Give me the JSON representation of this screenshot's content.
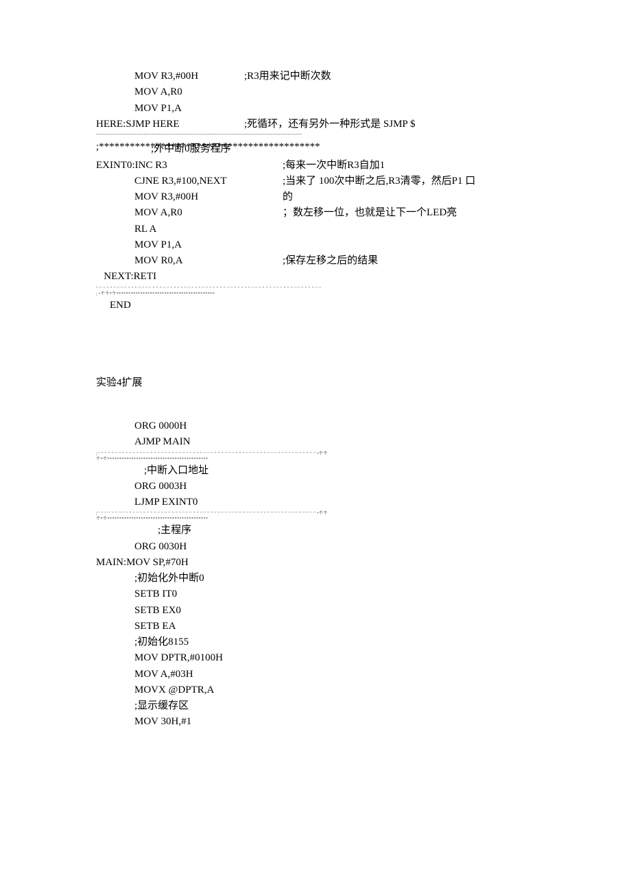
{
  "block1": {
    "lines": [
      {
        "indent": "indent1",
        "code": "MOV R3,#00H",
        "comment": ";R3用来记中断次数",
        "codeWidth": 160
      },
      {
        "indent": "indent1",
        "code": "MOV A,R0",
        "comment": "",
        "codeWidth": 160
      },
      {
        "indent": "indent1",
        "code": "MOV P1,A",
        "comment": "",
        "codeWidth": 160
      },
      {
        "indent": "label-line",
        "code": "HERE:SJMP HERE",
        "comment": ";死循环，还有另外一种形式是  SJMP $",
        "codeWidth": 216
      }
    ],
    "sep1": "''''''''''''''''''''''''''''''''''''''''''''''''''''''''''''''''''''''''''''''''''''''''''''''''''''''''''''''''''''''''''''''''''''''''''''''''''''''''''''''''''''''''''''''''''''''''''''''",
    "headerStars": ";*******************************************",
    "headerLabel": ";外中断0服务程序",
    "serviceLines": [
      {
        "indent": "label-line",
        "code": "EXINT0:INC R3",
        "comment": ";每来一次中断R3自加1",
        "codeWidth": 272
      },
      {
        "indent": "indent1",
        "code": "CJNE R3,#100,NEXT",
        "comment": ";当来了  100次中断之后,R3清零，然后P1 口",
        "codeWidth": 216
      },
      {
        "indent": "indent1",
        "code": "MOV R3,#00H",
        "comment": "的",
        "codeWidth": 216
      },
      {
        "indent": "indent1",
        "code": "MOV A,R0",
        "comment": "；数左移一位，也就是让下一个LED亮",
        "codeWidth": 216
      },
      {
        "indent": "indent1",
        "code": "RL A",
        "comment": "",
        "codeWidth": 216
      },
      {
        "indent": "indent1",
        "code": "MOV P1,A",
        "comment": "",
        "codeWidth": 216
      },
      {
        "indent": "indent1",
        "code": "MOV R0,A",
        "comment": ";保存左移之后的结果",
        "codeWidth": 216
      },
      {
        "indent": "label-line",
        "code": "   NEXT:RETI",
        "comment": "",
        "codeWidth": 216
      }
    ],
    "sep2a": "'' '' '' '' '' '' '' '' '' '' '' '' '' '' '' '' '' '' '' '' '' '' '' '' '' '' '' '' '' '' '' '' '' '' '' '' '' '' '' '' '' '' '' '' '' '' '' '' '' '' '' '' '' '' '' '' '' '' '' '' '' '' '' ''",
    "sep2b": ";                    •个个*个*****************************************",
    "end": "END"
  },
  "block2": {
    "title": "实验4扩展",
    "introLines": [
      {
        "indent": "indent1",
        "code": "ORG 0000H"
      },
      {
        "indent": "indent1",
        "code": "AJMP MAIN"
      }
    ],
    "sep3a": ";'' '' '' '' '' '' '' '' '' '' '' '' '' '' '' '' '' '' '' '' '' '' '' '' '' '' '' '' '' '' '' '' '' '' '' '' '' '' '' '' '' '' '' '' '' '' '' '' '' '' '' '' '' '' '' '' '' '' '' '' '' '' •个个",
    "sep3b": "个*个******************************************",
    "header2": ";中断入口地址",
    "intLines": [
      {
        "indent": "indent1",
        "code": "ORG 0003H"
      },
      {
        "indent": "indent1",
        "code": "LJMP EXINT0"
      }
    ],
    "sep4a": ";'' '' '' '' '' '' '' '' '' '' '' '' '' '' '' '' '' '' '' '' '' '' '' '' '' '' '' '' '' '' '' '' '' '' '' '' '' '' '' '' '' '' '' '' '' '' '' '' '' '' '' '' '' '' '' '' '' '' '' '' '' '' •个个",
    "sep4b": "个*个******************************************",
    "header3": ";主程序",
    "mainLines": [
      {
        "indent": "indent1",
        "code": "ORG 0030H"
      },
      {
        "indent": "label-line",
        "code": "MAIN:MOV SP,#70H"
      },
      {
        "indent": "indent1",
        "code": ";初始化外中断0"
      },
      {
        "indent": "indent1",
        "code": "SETB IT0"
      },
      {
        "indent": "indent1",
        "code": "SETB EX0"
      },
      {
        "indent": "indent1",
        "code": "SETB EA"
      },
      {
        "indent": "indent1",
        "code": ";初始化8155"
      },
      {
        "indent": "indent1",
        "code": "MOV DPTR,#0100H"
      },
      {
        "indent": "indent1",
        "code": "MOV A,#03H"
      },
      {
        "indent": "indent1",
        "code": "MOVX @DPTR,A"
      },
      {
        "indent": "indent1",
        "code": ";显示缓存区"
      },
      {
        "indent": "indent1",
        "code": "MOV 30H,#1"
      }
    ]
  }
}
